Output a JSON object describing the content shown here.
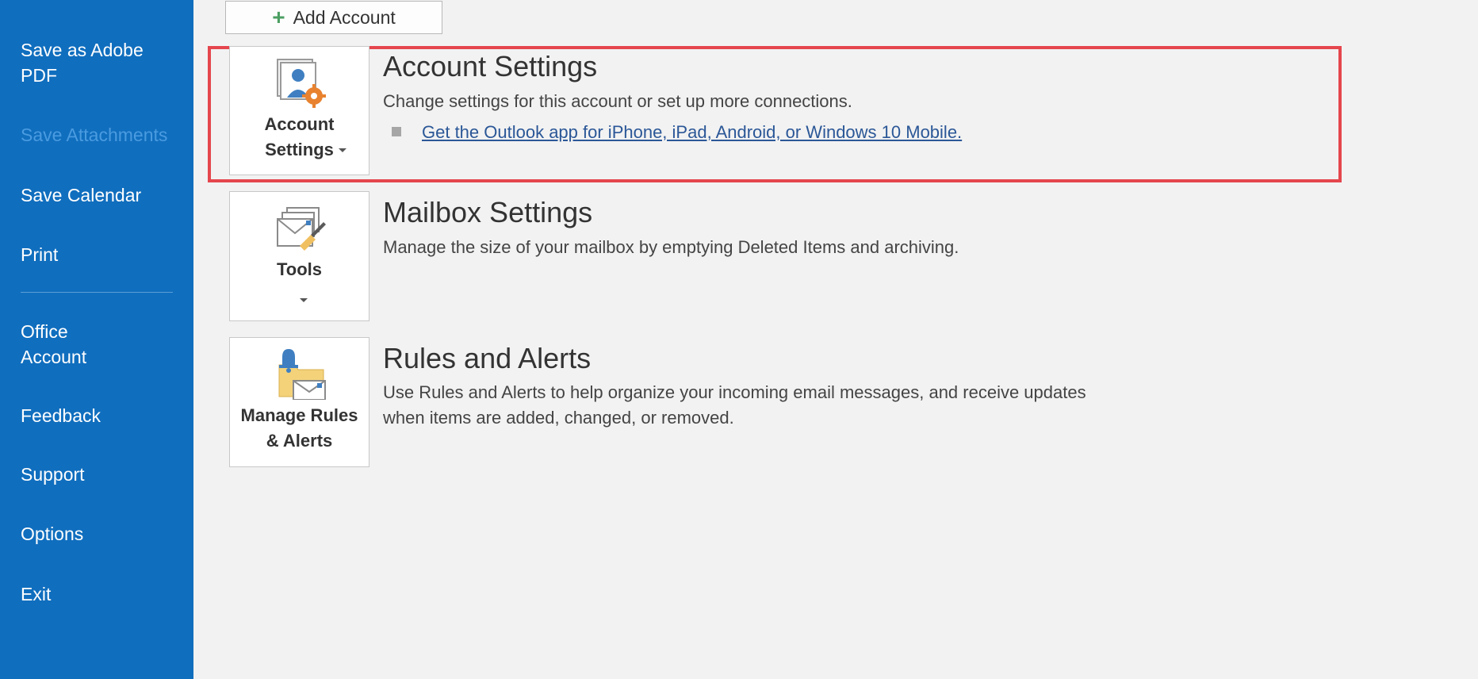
{
  "sidebar": {
    "items": [
      {
        "label": "Save as Adobe PDF",
        "disabled": false
      },
      {
        "label": "Save Attachments",
        "disabled": true
      },
      {
        "label": "Save Calendar",
        "disabled": false
      },
      {
        "label": "Print",
        "disabled": false
      },
      {
        "label": "Office Account",
        "disabled": false
      },
      {
        "label": "Feedback",
        "disabled": false
      },
      {
        "label": "Support",
        "disabled": false
      },
      {
        "label": "Options",
        "disabled": false
      },
      {
        "label": "Exit",
        "disabled": false
      }
    ]
  },
  "add_account": {
    "label": "Add Account",
    "icon": "plus-icon"
  },
  "sections": {
    "account_settings": {
      "button_label": "Account Settings",
      "title": "Account Settings",
      "description": "Change settings for this account or set up more connections.",
      "link": "Get the Outlook app for iPhone, iPad, Android, or Windows 10 Mobile.",
      "icon": "account-settings-icon"
    },
    "mailbox_settings": {
      "button_label": "Tools",
      "title": "Mailbox Settings",
      "description": "Manage the size of your mailbox by emptying Deleted Items and archiving.",
      "icon": "tools-icon"
    },
    "rules_alerts": {
      "button_label": "Manage Rules & Alerts",
      "title": "Rules and Alerts",
      "description": "Use Rules and Alerts to help organize your incoming email messages, and receive updates when items are added, changed, or removed.",
      "icon": "rules-alerts-icon"
    }
  },
  "colors": {
    "sidebar": "#106ebe",
    "highlight": "#e5464d",
    "link": "#2b5797"
  }
}
